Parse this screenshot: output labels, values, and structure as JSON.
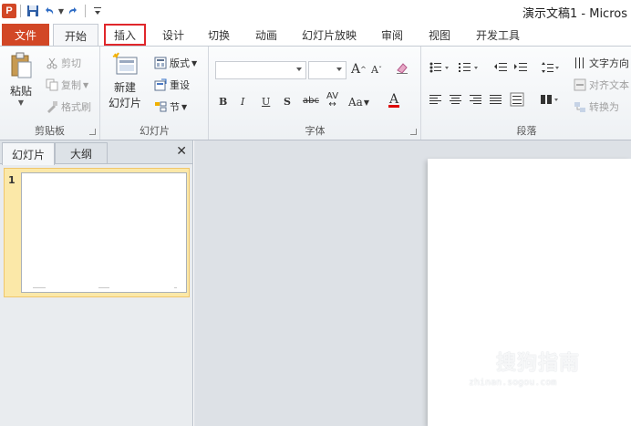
{
  "window": {
    "title": "演示文稿1 - Micros",
    "app_logo": "P"
  },
  "ribbon_tabs": [
    {
      "label": "文件"
    },
    {
      "label": "开始"
    },
    {
      "label": "插入"
    },
    {
      "label": "设计"
    },
    {
      "label": "切换"
    },
    {
      "label": "动画"
    },
    {
      "label": "幻灯片放映"
    },
    {
      "label": "审阅"
    },
    {
      "label": "视图"
    },
    {
      "label": "开发工具"
    }
  ],
  "clipboard": {
    "group_label": "剪贴板",
    "paste": "粘贴",
    "cut": "剪切",
    "copy": "复制",
    "format_painter": "格式刷"
  },
  "slides_group": {
    "group_label": "幻灯片",
    "new_slide_line1": "新建",
    "new_slide_line2": "幻灯片",
    "layout": "版式",
    "reset": "重设",
    "section": "节"
  },
  "font_group": {
    "group_label": "字体",
    "bold": "B",
    "italic": "I",
    "underline": "U",
    "shadow": "S",
    "strike": "abc",
    "spacing": "AV",
    "case": "Aa",
    "font_color": "A",
    "grow": "A",
    "shrink": "A"
  },
  "paragraph_group": {
    "group_label": "段落",
    "text_direction": "文字方向",
    "align_text": "对齐文本",
    "convert": "转换为"
  },
  "left_pane": {
    "tab_slides": "幻灯片",
    "tab_outline": "大纲",
    "close": "✕",
    "slide_number": "1"
  },
  "watermark": {
    "main": "搜狗指南",
    "sub": "zhinan.sogou.com"
  },
  "colors": {
    "file_tab": "#d24726",
    "highlight_box": "#e0272b",
    "selected_thumb": "#fbe8a8"
  }
}
